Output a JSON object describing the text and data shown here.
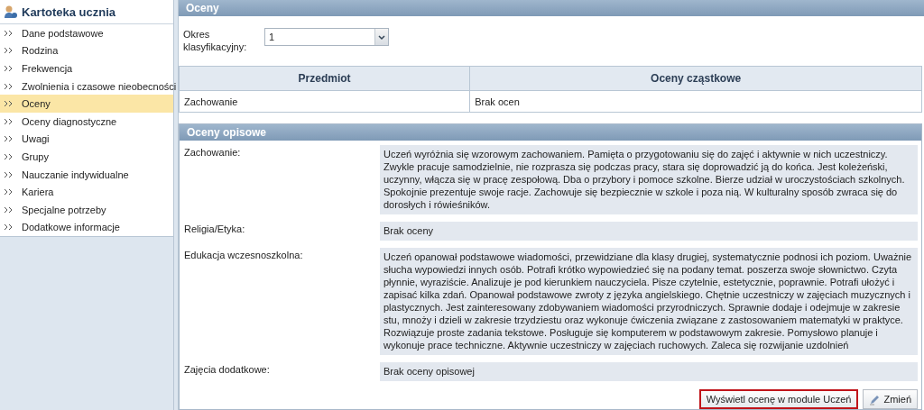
{
  "sidebar": {
    "title": "Kartoteka ucznia",
    "items": [
      {
        "label": "Dane podstawowe",
        "selected": false
      },
      {
        "label": "Rodzina",
        "selected": false
      },
      {
        "label": "Frekwencja",
        "selected": false
      },
      {
        "label": "Zwolnienia i czasowe nieobecności",
        "selected": false
      },
      {
        "label": "Oceny",
        "selected": true
      },
      {
        "label": "Oceny diagnostyczne",
        "selected": false
      },
      {
        "label": "Uwagi",
        "selected": false
      },
      {
        "label": "Grupy",
        "selected": false
      },
      {
        "label": "Nauczanie indywidualne",
        "selected": false
      },
      {
        "label": "Kariera",
        "selected": false
      },
      {
        "label": "Specjalne potrzeby",
        "selected": false
      },
      {
        "label": "Dodatkowe informacje",
        "selected": false
      }
    ]
  },
  "panel": {
    "title": "Oceny",
    "period_label": "Okres klasyfikacyjny:",
    "period_value": "1"
  },
  "table": {
    "columns": [
      "Przedmiot",
      "Oceny cząstkowe"
    ],
    "rows": [
      {
        "cells": [
          "Zachowanie",
          "Brak ocen"
        ]
      }
    ]
  },
  "descriptive": {
    "title": "Oceny opisowe",
    "items": [
      {
        "label": "Zachowanie:",
        "text": "Uczeń wyróżnia się wzorowym zachowaniem. Pamięta o przygotowaniu się do zajęć i aktywnie w nich uczestniczy. Zwykle pracuje samodzielnie, nie rozprasza się podczas pracy, stara się doprowadzić ją do końca. Jest koleżeński, uczynny, włącza się w pracę zespołową. Dba o przybory i pomoce szkolne. Bierze udział w uroczystościach szkolnych. Spokojnie prezentuje swoje racje. Zachowuje się bezpiecznie w szkole i poza nią. W kulturalny sposób zwraca się do dorosłych i rówieśników."
      },
      {
        "label": "Religia/Etyka:",
        "text": "Brak oceny"
      },
      {
        "label": "Edukacja wczesnoszkolna:",
        "text": "Uczeń opanował podstawowe wiadomości, przewidziane dla klasy drugiej, systematycznie podnosi ich poziom. Uważnie słucha wypowiedzi innych osób. Potrafi krótko wypowiedzieć się na podany temat. poszerza swoje słownictwo. Czyta płynnie, wyraziście. Analizuje je pod kierunkiem nauczyciela. Pisze czytelnie, estetycznie, poprawnie. Potrafi ułożyć i zapisać kilka zdań. Opanował podstawowe zwroty z języka angielskiego. Chętnie uczestniczy w zajęciach muzycznych i plastycznych. Jest zainteresowany zdobywaniem wiadomości przyrodniczych. Sprawnie dodaje i odejmuje w zakresie stu, mnoży i dzieli w zakresie trzydziestu oraz wykonuje ćwiczenia związane z zastosowaniem matematyki w praktyce. Rozwiązuje proste zadania tekstowe. Posługuje się komputerem w podstawowym zakresie. Pomysłowo planuje i wykonuje prace techniczne. Aktywnie uczestniczy w zajęciach ruchowych. Zaleca się rozwijanie uzdolnień"
      },
      {
        "label": "Zajęcia dodatkowe:",
        "text": "Brak oceny opisowej"
      }
    ],
    "buttons": [
      {
        "label": "Wyświetl ocenę w module Uczeń",
        "kind": "focused"
      },
      {
        "label": "Zmień",
        "kind": "edit"
      }
    ]
  }
}
